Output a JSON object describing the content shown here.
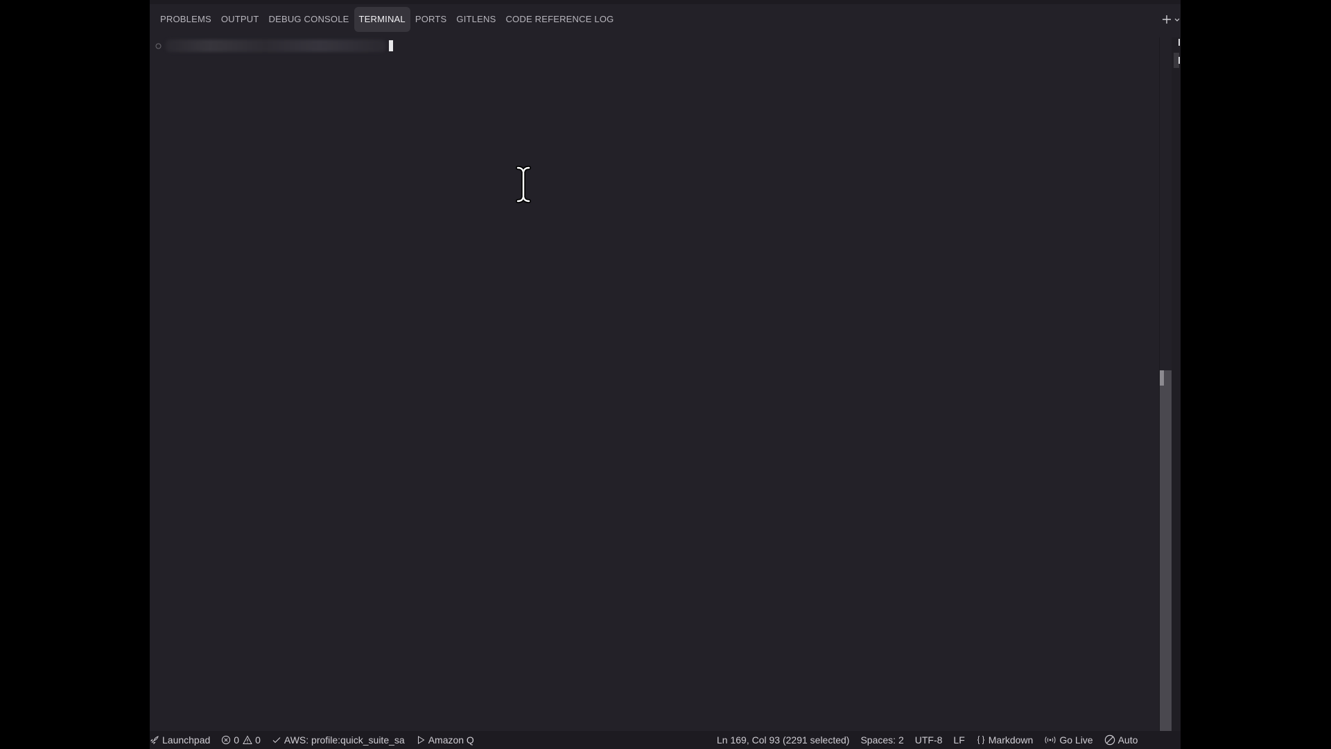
{
  "panel": {
    "tabs": [
      {
        "label": "PROBLEMS"
      },
      {
        "label": "OUTPUT"
      },
      {
        "label": "DEBUG CONSOLE"
      },
      {
        "label": "TERMINAL"
      },
      {
        "label": "PORTS"
      },
      {
        "label": "GITLENS"
      },
      {
        "label": "CODE REFERENCE LOG"
      }
    ],
    "active_tab": "TERMINAL",
    "actions": {
      "add_icon": "plus-icon",
      "dropdown_icon": "chevron-down-icon"
    }
  },
  "terminal": {
    "prompt_icon": "circle-icon",
    "cursor_icon": "text-cursor-icon"
  },
  "statusbar": {
    "launchpad": "Launchpad",
    "errors": "0",
    "warnings": "0",
    "aws_profile": "AWS: profile:quick_suite_sa",
    "amazon_q": "Amazon Q",
    "cursor_position": "Ln 169, Col 93 (2291 selected)",
    "spaces": "Spaces: 2",
    "encoding": "UTF-8",
    "eol": "LF",
    "language": "Markdown",
    "go_live": "Go Live",
    "auto": "Auto"
  },
  "colors": {
    "background": "#232128",
    "statusbar": "#1d1b21",
    "active_tab": "#37353c",
    "text": "#cfcdd3"
  }
}
